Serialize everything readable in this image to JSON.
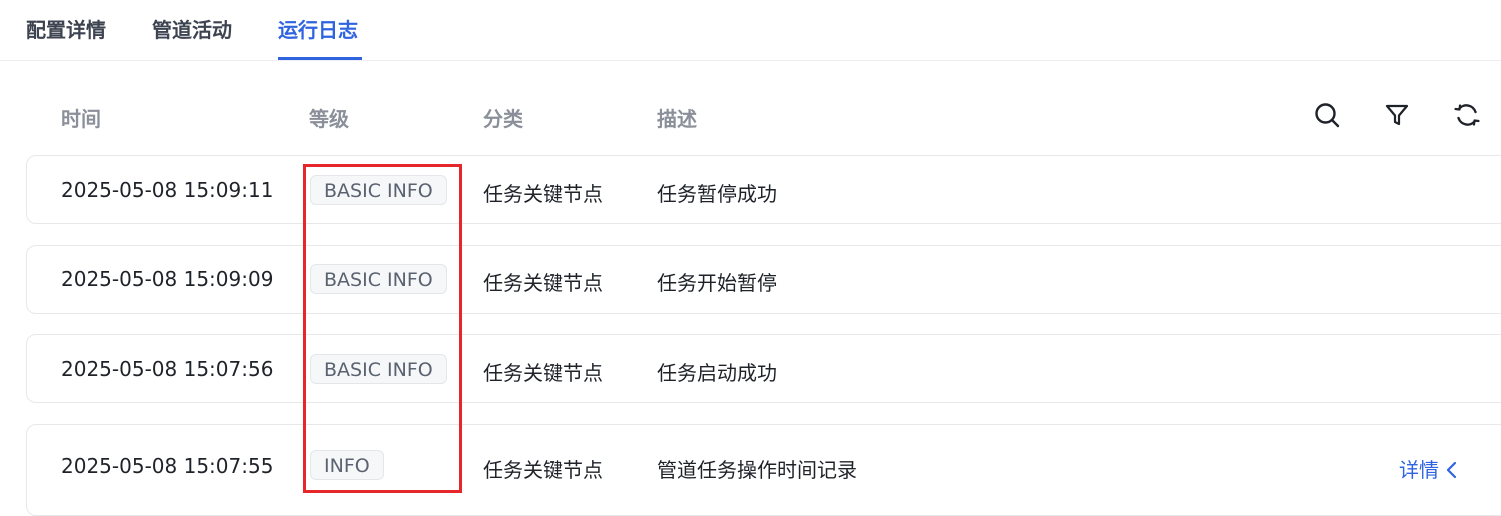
{
  "tabs": [
    {
      "label": "配置详情",
      "active": false
    },
    {
      "label": "管道活动",
      "active": false
    },
    {
      "label": "运行日志",
      "active": true
    }
  ],
  "table": {
    "headers": {
      "time": "时间",
      "level": "等级",
      "category": "分类",
      "description": "描述"
    },
    "toolbar": {
      "search_icon": "search-icon",
      "filter_icon": "filter-icon",
      "refresh_icon": "refresh-icon"
    },
    "rows": [
      {
        "time": "2025-05-08 15:09:11",
        "level": "BASIC INFO",
        "category": "任务关键节点",
        "description": "任务暂停成功"
      },
      {
        "time": "2025-05-08 15:09:09",
        "level": "BASIC INFO",
        "category": "任务关键节点",
        "description": "任务开始暂停"
      },
      {
        "time": "2025-05-08 15:07:56",
        "level": "BASIC INFO",
        "category": "任务关键节点",
        "description": "任务启动成功"
      },
      {
        "time": "2025-05-08 15:07:55",
        "level": "INFO",
        "category": "任务关键节点",
        "description": "管道任务操作时间记录",
        "detail_label": "详情"
      }
    ]
  },
  "colors": {
    "accent": "#2f63e0",
    "highlight": "#e5262b",
    "header_text": "#8a8f99"
  }
}
